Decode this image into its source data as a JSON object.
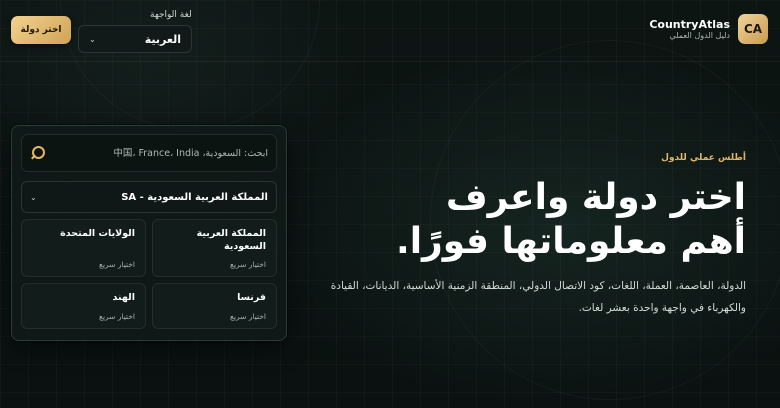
{
  "brand": {
    "logo": "CA",
    "name": "CountryAtlas",
    "subtitle": "دليل الدول العملي"
  },
  "language": {
    "label": "لغة الواجهة",
    "selected": "العربية"
  },
  "header": {
    "pick_button": "اختر دولة"
  },
  "hero": {
    "eyebrow": "أطلس عملي للدول",
    "title": "اختر دولة واعرف أهم معلوماتها فورًا.",
    "description": "الدولة، العاصمة، العملة، اللغات، كود الاتصال الدولي، المنطقة الزمنية الأساسية، الديانات، القيادة والكهرباء في واجهة واحدة بعشر لغات."
  },
  "panel": {
    "search_placeholder": "ابحث: السعودية، 中国، France، India",
    "country_selected": "المملكة العربية السعودية - SA",
    "quick_cards": [
      {
        "name": "المملكة العربية السعودية",
        "sub": "اختيار سريع"
      },
      {
        "name": "الولايات المتحدة",
        "sub": "اختيار سريع"
      },
      {
        "name": "فرنسا",
        "sub": "اختيار سريع"
      },
      {
        "name": "الهند",
        "sub": "اختيار سريع"
      }
    ]
  },
  "colors": {
    "accent": "#e1b766",
    "background": "#0b1210"
  },
  "icons": {
    "search": "search-icon",
    "chevron": "chevron-down-icon"
  }
}
